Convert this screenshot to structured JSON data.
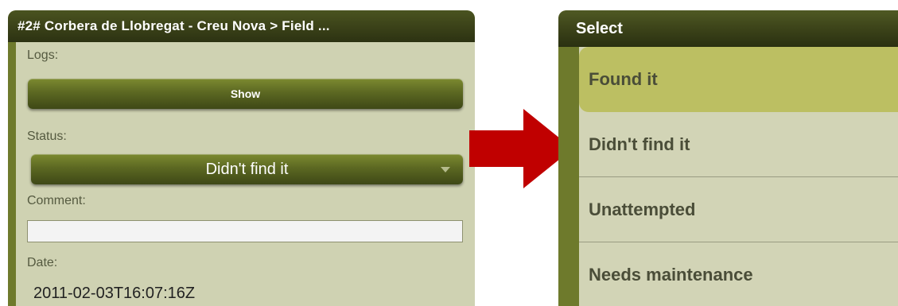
{
  "detail_panel": {
    "title": "#2# Corbera de Llobregat - Creu Nova > Field ...",
    "logs_label": "Logs:",
    "show_button": "Show",
    "status_label": "Status:",
    "status_value": "Didn't find it",
    "comment_label": "Comment:",
    "comment_value": "",
    "date_label": "Date:",
    "date_value": "2011-02-03T16:07:16Z"
  },
  "select_panel": {
    "title": "Select",
    "options": [
      {
        "label": "Found it",
        "selected": true
      },
      {
        "label": "Didn't find it",
        "selected": false
      },
      {
        "label": "Unattempted",
        "selected": false
      },
      {
        "label": "Needs maintenance",
        "selected": false
      }
    ]
  },
  "colors": {
    "frame": "#6e7a2c",
    "titlebar": "#3a4118",
    "panel_bg": "#cfd2b2",
    "selected_option": "#bcbf62",
    "arrow": "#c00000"
  },
  "icons": {
    "arrow": "right-arrow-icon",
    "dropdown": "chevron-down-icon"
  }
}
